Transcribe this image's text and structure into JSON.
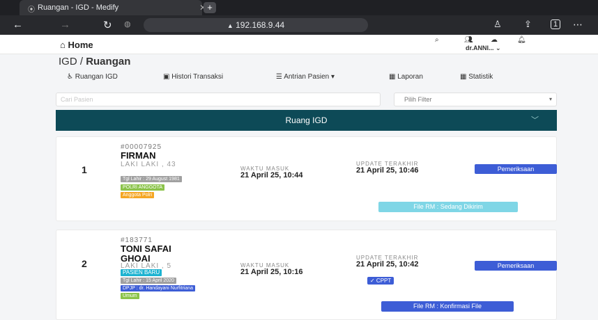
{
  "browser": {
    "tab_title": "Ruangan - IGD - Medify",
    "url": "192.168.9.44"
  },
  "header": {
    "home_label": "Home",
    "user_label": "dr.ANNI... ⌄"
  },
  "breadcrumb": {
    "parent": "IGD /",
    "current": "Ruangan"
  },
  "menu": {
    "ruangan_igd": "Ruangan IGD",
    "histori": "Histori Transaksi",
    "antrian": "Antrian Pasien ▾",
    "laporan": "Laporan",
    "statistik": "Statistik"
  },
  "search": {
    "placeholder": "Cari Pasien"
  },
  "filter": {
    "placeholder": "Pilih Filter"
  },
  "section": {
    "title": "Ruang IGD"
  },
  "patients": [
    {
      "num": "1",
      "rm": "#00007925",
      "name": "FIRMAN",
      "sex_age": "LAKI LAKI , 43",
      "dob": "Tgl Lahir : 29 August 1981",
      "tag1": "POLRI ANGGOTA",
      "tag2": "Anggota Polri",
      "waktu_masuk_label": "WAKTU MASUK",
      "waktu_masuk": "21 April 25, 10:44",
      "update_label": "UPDATE TERAKHIR",
      "update": "21 April 25, 10:46",
      "action": "Pemeriksaan",
      "file_status": "File RM : Sedang Dikirim"
    },
    {
      "num": "2",
      "rm": "#183771",
      "name": "TONI SAFAI GHOAI",
      "sex_age": "LAKI LAKI , 5",
      "status": "PASIEN BARU",
      "dob": "Tgl Lahir : 15 April 2020",
      "dpjp": "DPJP : dr. Handayani Nurfitriana",
      "tag": "Umum",
      "waktu_masuk_label": "WAKTU MASUK",
      "waktu_masuk": "21 April 25, 10:16",
      "update_label": "UPDATE TERAKHIR",
      "update": "21 April 25, 10:42",
      "cppt": "✓ CPPT",
      "action": "Pemeriksaan",
      "file_status": "File RM : Konfirmasi File"
    }
  ],
  "colors": {
    "section_bar": "#0d4a57",
    "primary_button": "#3d5dd6",
    "file_sending": "#7fd6e6",
    "badge_grey": "#a0a0a0",
    "badge_green": "#8bc34a",
    "badge_orange": "#f5a623",
    "badge_cyan": "#1db3d1",
    "badge_blue": "#3d5dd6"
  }
}
